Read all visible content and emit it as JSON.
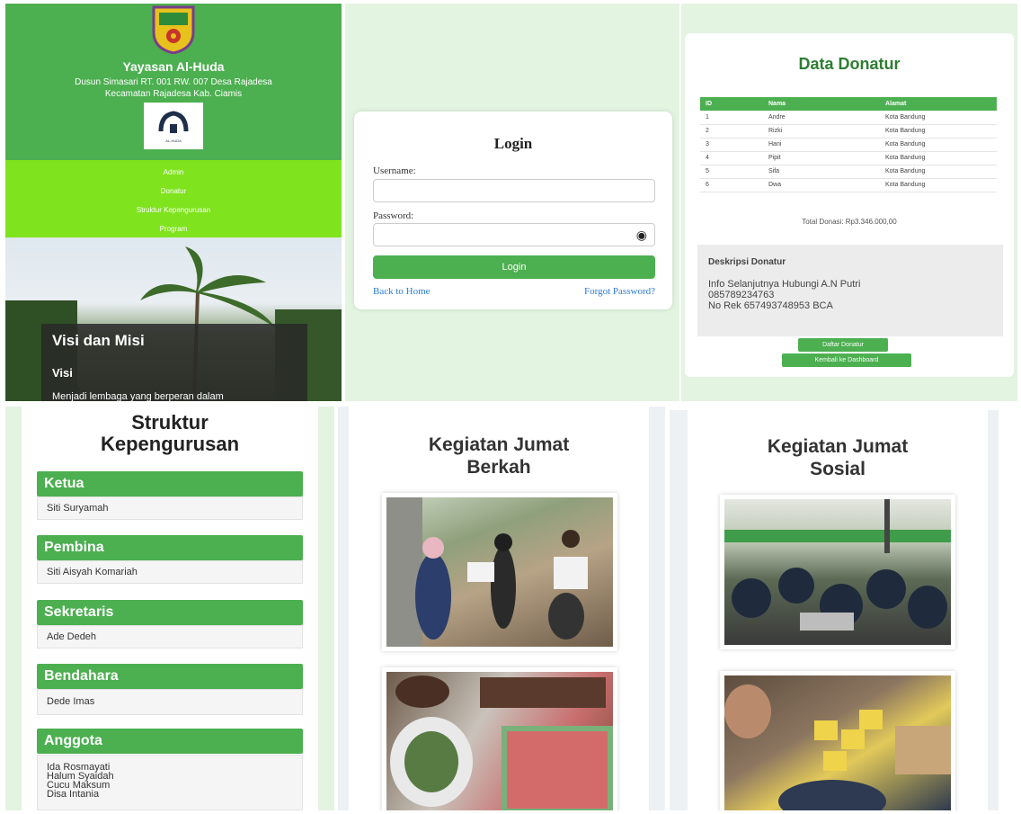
{
  "home": {
    "org_name": "Yayasan Al-Huda",
    "address_line1": "Dusun Simasari RT. 001 RW. 007 Desa Rajadesa",
    "address_line2": "Kecamatan Rajadesa Kab. Ciamis",
    "logo_caption": "AL-HUDA",
    "nav": [
      "Admin",
      "Donatur",
      "Struktur Kepengurusan",
      "Program"
    ],
    "visi_misi_title": "Visi dan Misi",
    "visi_label": "Visi",
    "visi_text": "Menjadi lembaga yang berperan dalam"
  },
  "login": {
    "title": "Login",
    "username_label": "Username:",
    "password_label": "Password:",
    "eye_icon": "◉",
    "button": "Login",
    "back_link": "Back to Home",
    "forgot_link": "Forgot Password?"
  },
  "donatur": {
    "title": "Data Donatur",
    "columns": [
      "ID",
      "Nama",
      "Alamat"
    ],
    "rows": [
      [
        "1",
        "Andre",
        "Kota Bandung"
      ],
      [
        "2",
        "Rizki",
        "Kota Bandung"
      ],
      [
        "3",
        "Hani",
        "Kota Bandung"
      ],
      [
        "4",
        "Pipit",
        "Kota Bandung"
      ],
      [
        "5",
        "Sifa",
        "Kota Bandung"
      ],
      [
        "6",
        "Dwa",
        "Kota Bandung"
      ]
    ],
    "total": "Total Donasi: Rp3.346.000,00",
    "desc_title": "Deskripsi Donatur",
    "desc_lines": [
      "Info Selanjutnya Hubungi A.N Putri",
      "085789234763",
      "No Rek 657493748953 BCA"
    ],
    "btn_daftar": "Daftar Donatur",
    "btn_kembali": "Kembali ke Dashboard"
  },
  "struktur": {
    "title_line1": "Struktur",
    "title_line2": "Kepengurusan",
    "roles": [
      {
        "role": "Ketua",
        "members": [
          "Siti Suryamah"
        ]
      },
      {
        "role": "Pembina",
        "members": [
          "Siti Aisyah Komariah"
        ]
      },
      {
        "role": "Sekretaris",
        "members": [
          "Ade Dedeh"
        ]
      },
      {
        "role": "Bendahara",
        "members": [
          "Dede Imas"
        ]
      },
      {
        "role": "Anggota",
        "members": [
          "Ida Rosmayati",
          "Halum Syaidah",
          "Cucu Maksum",
          "Disa Intania"
        ]
      }
    ]
  },
  "jumat_berkah": {
    "title_line1": "Kegiatan Jumat",
    "title_line2": "Berkah"
  },
  "jumat_sosial": {
    "title_line1": "Kegiatan Jumat",
    "title_line2": "Sosial"
  },
  "colors": {
    "primary_green": "#4caf50",
    "lime_nav": "#7fe31e",
    "light_green_bg": "#e3f4e1",
    "link_blue": "#2b7bd8"
  }
}
